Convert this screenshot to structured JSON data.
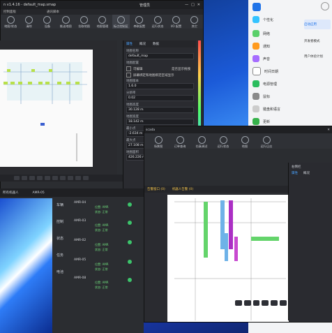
{
  "window1": {
    "title": "n v1.4.16 - default_map.smap",
    "account": "管理员",
    "menu": [
      "控制面板",
      "通讯脚本"
    ],
    "tools": [
      "地图/状态",
      "清除",
      "设备",
      "推送地图",
      "拉取地图",
      "地图管理",
      "标点控制区",
      "串联配置",
      "运行状态",
      "I/O 配置",
      "其它"
    ],
    "props_tabs": [
      "属性",
      "概况",
      "数据"
    ],
    "props": [
      {
        "label": "地图名称",
        "value": "default_map"
      },
      {
        "label": "地图配置",
        "value": ""
      }
    ],
    "checks": [
      "可编辑",
      "是否显示拖拽",
      "屏幕绑定和地图绑定区域显示"
    ],
    "more_props": [
      {
        "label": "地图版本",
        "value": "1.6.0"
      },
      {
        "label": "分辨率",
        "value": "0.02"
      },
      {
        "label": "地图高度",
        "value": "30.128 m"
      },
      {
        "label": "地图宽度",
        "value": "18.142 m"
      }
    ],
    "min_label": "最小点",
    "min_values": [
      "-2.634 m",
      "-6.562 m"
    ],
    "max_label": "最大点",
    "max_values": [
      "27.108 m",
      "4.579 m"
    ],
    "area_label": "地图面积",
    "area_value": "426.226 m²",
    "colors": {
      "accent": "#4aa3ff"
    }
  },
  "window2": {
    "header": [
      "所有机器人",
      "AMR-05"
    ],
    "side_labels": [
      "车辆",
      "控制",
      "状态",
      "任务",
      "电池"
    ],
    "robots": [
      {
        "name": "AMR-04",
        "line1": "位置: AMR",
        "line2": "状态: 正常"
      },
      {
        "name": "AMR-03",
        "line1": "位置: AMR",
        "line2": "状态: 正常"
      },
      {
        "name": "AMR-02",
        "line1": "位置: AMR",
        "line2": "状态: 正常"
      },
      {
        "name": "AMR-05",
        "line1": "位置: AMR",
        "line2": "状态: 正常"
      },
      {
        "name": "AMR-08",
        "line1": "位置: AMR",
        "line2": "状态: 正常"
      }
    ]
  },
  "window3": {
    "title": "scada",
    "tools": [
      "场景图",
      "订单查询",
      "仿真调试",
      "运行状态",
      "地图",
      "运行日志"
    ],
    "tabs": [
      "告警窗口 (0)",
      "机器人告警 (0)"
    ],
    "right_panel_title": "右侧栏",
    "right_tabs": [
      "属性",
      "概况"
    ]
  },
  "settings": {
    "items": [
      "个性化",
      "网络",
      "通知",
      "声音",
      "时间日期",
      "电源管理",
      "鼠标",
      "键盘和语言",
      "更新"
    ],
    "side_buttons": [
      "启动应用",
      "开发者模式",
      "用户体验计划"
    ]
  }
}
